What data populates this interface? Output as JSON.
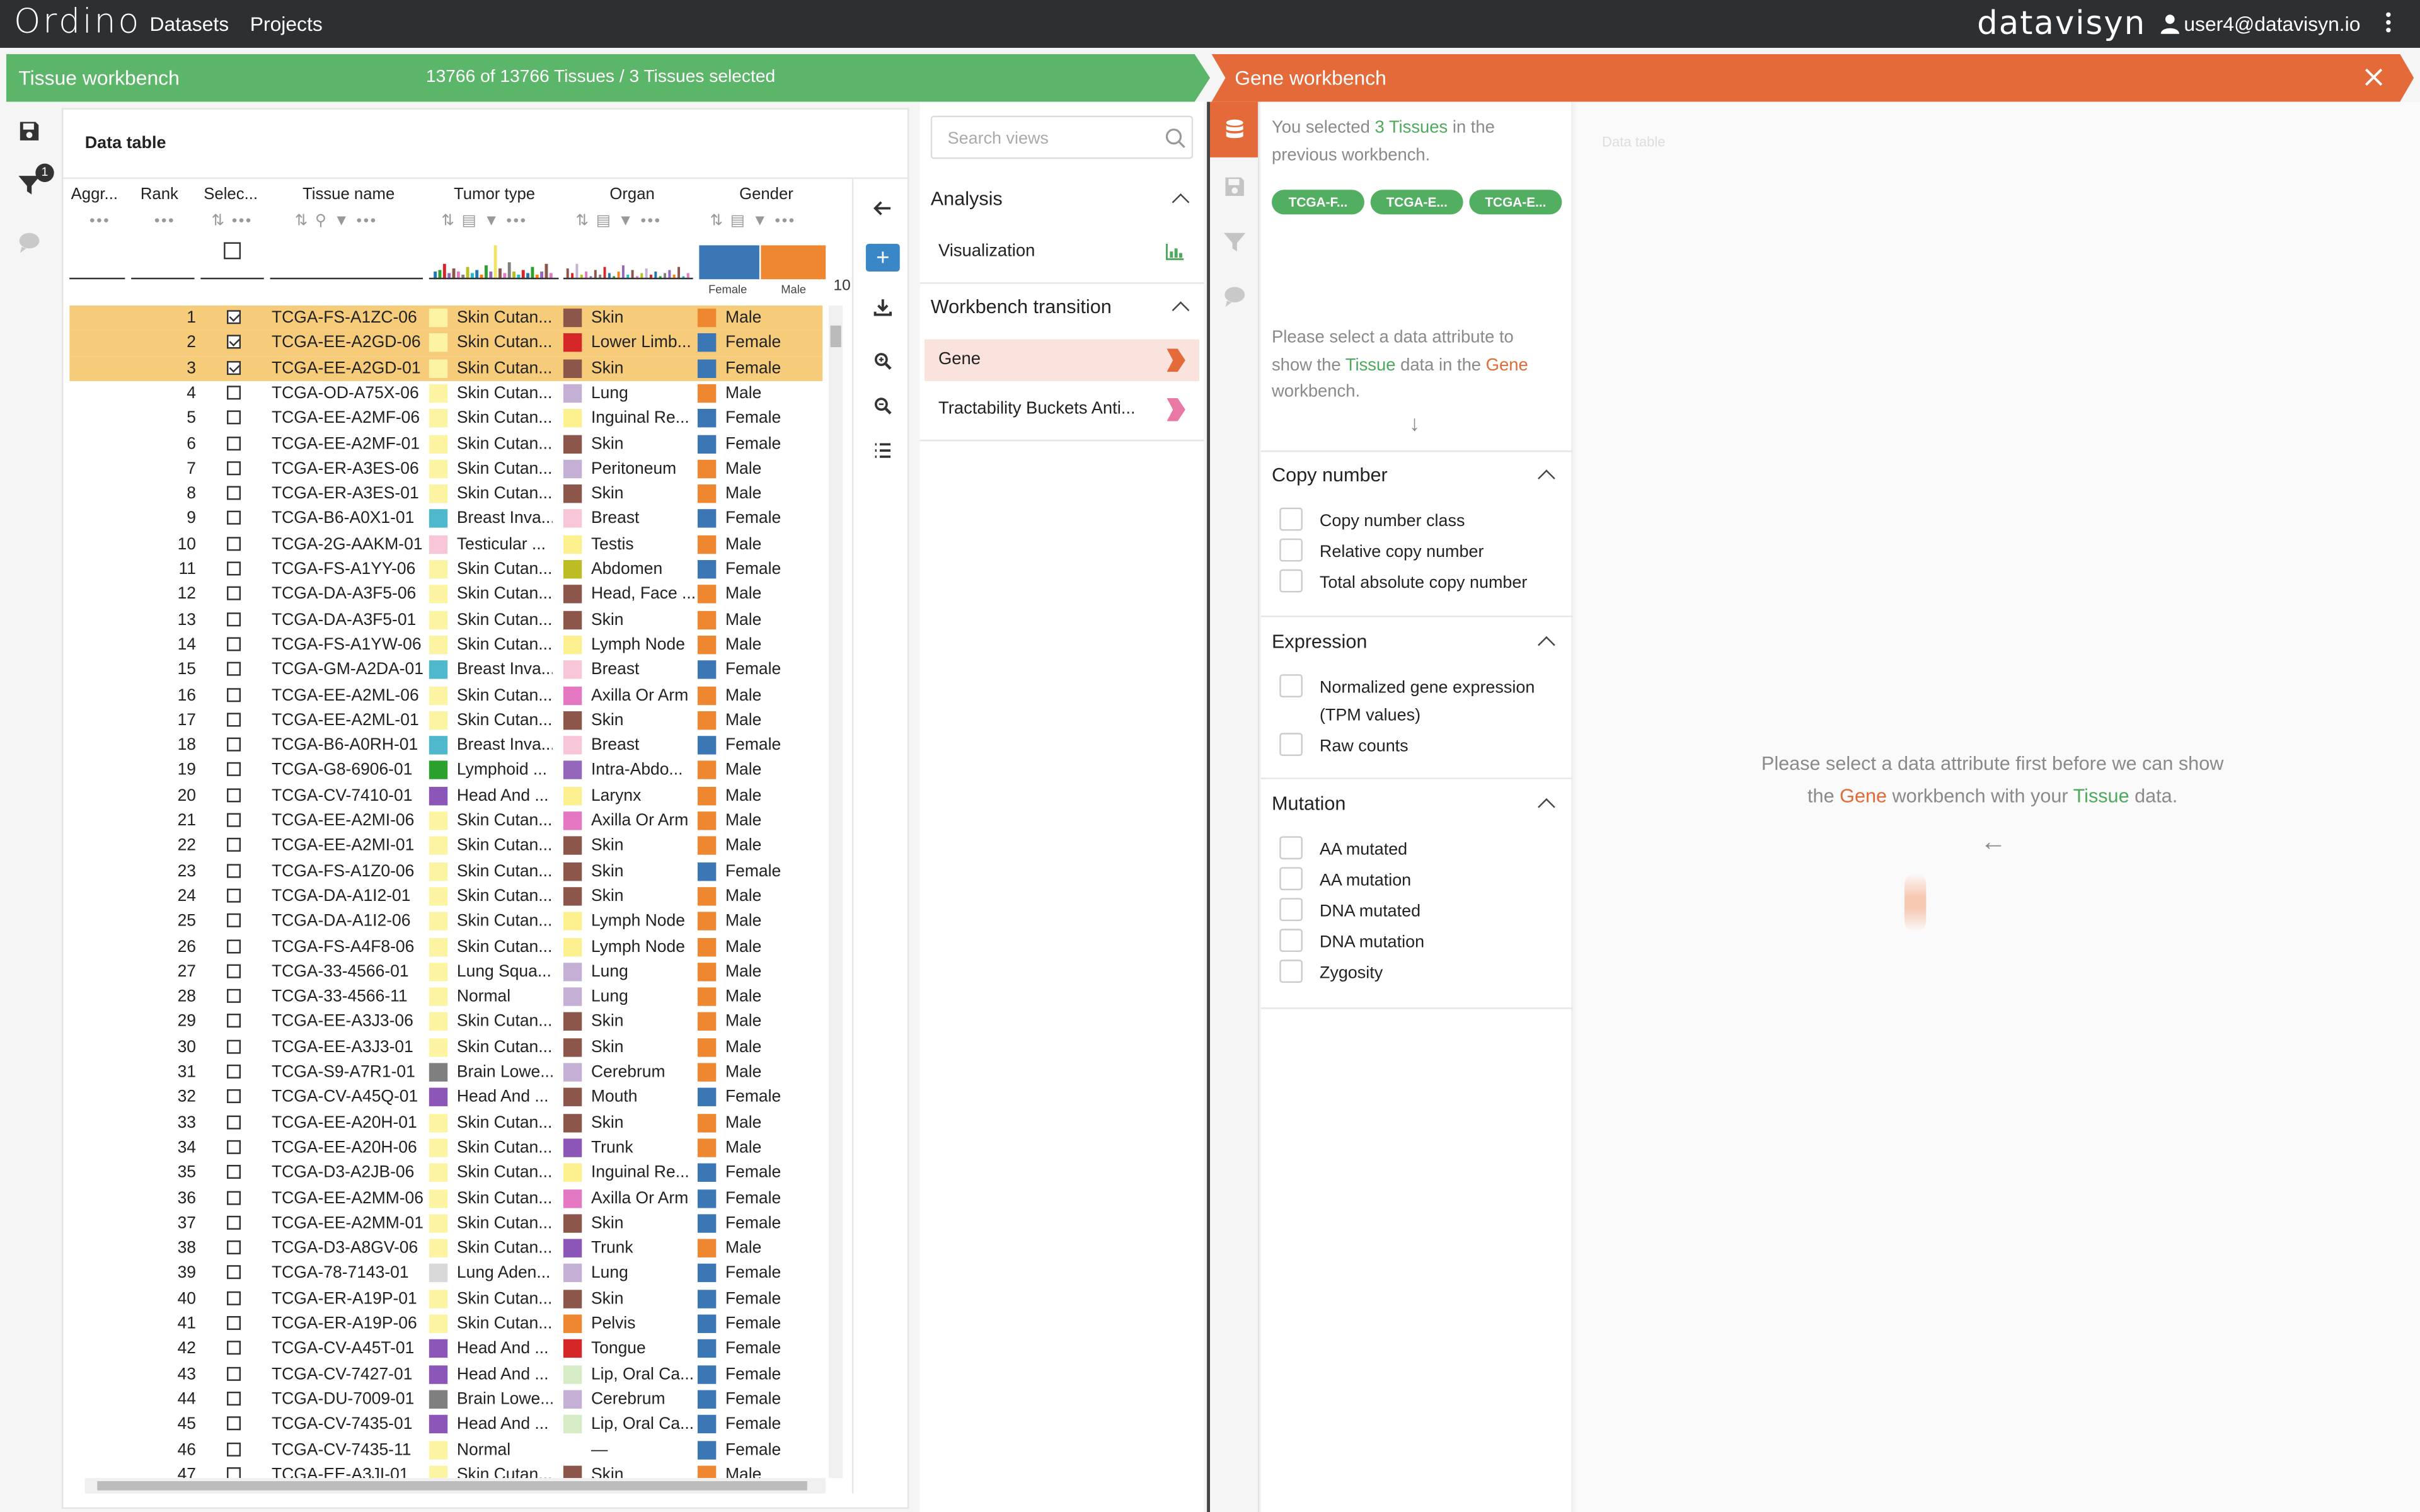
{
  "topbar": {
    "brand": "Ordino",
    "nav": [
      "Datasets",
      "Projects"
    ],
    "logo": "datavisyn",
    "user": "user4@datavisyn.io"
  },
  "tissue_workbench": {
    "title": "Tissue workbench",
    "status": "13766 of 13766 Tissues / 3 Tissues selected",
    "filter_badge": "1"
  },
  "gene_workbench": {
    "title": "Gene workbench"
  },
  "data_table": {
    "title": "Data table",
    "columns": [
      "Aggr...",
      "Rank",
      "Selec...",
      "Tissue name",
      "Tumor type",
      "Organ",
      "Gender"
    ],
    "gender_hist": {
      "female_label": "Female",
      "male_label": "Male",
      "female_fraction": 0.49,
      "overflow": "10"
    },
    "rows": [
      {
        "rank": "1",
        "name": "TCGA-FS-A1ZC-06",
        "tumor": "Skin Cutan...",
        "tc": "#fdf4a3",
        "organ": "Skin",
        "oc": "#8c564b",
        "gender": "Male",
        "sel": true
      },
      {
        "rank": "2",
        "name": "TCGA-EE-A2GD-06",
        "tumor": "Skin Cutan...",
        "tc": "#fdf4a3",
        "organ": "Lower Limb...",
        "oc": "#d62728",
        "gender": "Female",
        "sel": true
      },
      {
        "rank": "3",
        "name": "TCGA-EE-A2GD-01",
        "tumor": "Skin Cutan...",
        "tc": "#fdf4a3",
        "organ": "Skin",
        "oc": "#8c564b",
        "gender": "Female",
        "sel": true
      },
      {
        "rank": "4",
        "name": "TCGA-OD-A75X-06",
        "tumor": "Skin Cutan...",
        "tc": "#fdf4a3",
        "organ": "Lung",
        "oc": "#c5b0d5",
        "gender": "Male",
        "sel": false
      },
      {
        "rank": "5",
        "name": "TCGA-EE-A2MF-06",
        "tumor": "Skin Cutan...",
        "tc": "#fdf4a3",
        "organ": "Inguinal Re...",
        "oc": "#fdf08f",
        "gender": "Female",
        "sel": false
      },
      {
        "rank": "6",
        "name": "TCGA-EE-A2MF-01",
        "tumor": "Skin Cutan...",
        "tc": "#fdf4a3",
        "organ": "Skin",
        "oc": "#8c564b",
        "gender": "Female",
        "sel": false
      },
      {
        "rank": "7",
        "name": "TCGA-ER-A3ES-06",
        "tumor": "Skin Cutan...",
        "tc": "#fdf4a3",
        "organ": "Peritoneum",
        "oc": "#c5b0d5",
        "gender": "Male",
        "sel": false
      },
      {
        "rank": "8",
        "name": "TCGA-ER-A3ES-01",
        "tumor": "Skin Cutan...",
        "tc": "#fdf4a3",
        "organ": "Skin",
        "oc": "#8c564b",
        "gender": "Male",
        "sel": false
      },
      {
        "rank": "9",
        "name": "TCGA-B6-A0X1-01",
        "tumor": "Breast Inva...",
        "tc": "#4fb8cc",
        "organ": "Breast",
        "oc": "#f7c6d9",
        "gender": "Female",
        "sel": false
      },
      {
        "rank": "10",
        "name": "TCGA-2G-AAKM-01",
        "tumor": "Testicular ...",
        "tc": "#f7c6d9",
        "organ": "Testis",
        "oc": "#fdf08f",
        "gender": "Male",
        "sel": false
      },
      {
        "rank": "11",
        "name": "TCGA-FS-A1YY-06",
        "tumor": "Skin Cutan...",
        "tc": "#fdf4a3",
        "organ": "Abdomen",
        "oc": "#bcbd22",
        "gender": "Female",
        "sel": false
      },
      {
        "rank": "12",
        "name": "TCGA-DA-A3F5-06",
        "tumor": "Skin Cutan...",
        "tc": "#fdf4a3",
        "organ": "Head, Face ...",
        "oc": "#8c564b",
        "gender": "Male",
        "sel": false
      },
      {
        "rank": "13",
        "name": "TCGA-DA-A3F5-01",
        "tumor": "Skin Cutan...",
        "tc": "#fdf4a3",
        "organ": "Skin",
        "oc": "#8c564b",
        "gender": "Male",
        "sel": false
      },
      {
        "rank": "14",
        "name": "TCGA-FS-A1YW-06",
        "tumor": "Skin Cutan...",
        "tc": "#fdf4a3",
        "organ": "Lymph Node",
        "oc": "#fdf08f",
        "gender": "Male",
        "sel": false
      },
      {
        "rank": "15",
        "name": "TCGA-GM-A2DA-01",
        "tumor": "Breast Inva...",
        "tc": "#4fb8cc",
        "organ": "Breast",
        "oc": "#f7c6d9",
        "gender": "Female",
        "sel": false
      },
      {
        "rank": "16",
        "name": "TCGA-EE-A2ML-06",
        "tumor": "Skin Cutan...",
        "tc": "#fdf4a3",
        "organ": "Axilla Or Arm",
        "oc": "#e377c2",
        "gender": "Male",
        "sel": false
      },
      {
        "rank": "17",
        "name": "TCGA-EE-A2ML-01",
        "tumor": "Skin Cutan...",
        "tc": "#fdf4a3",
        "organ": "Skin",
        "oc": "#8c564b",
        "gender": "Male",
        "sel": false
      },
      {
        "rank": "18",
        "name": "TCGA-B6-A0RH-01",
        "tumor": "Breast Inva...",
        "tc": "#4fb8cc",
        "organ": "Breast",
        "oc": "#f7c6d9",
        "gender": "Female",
        "sel": false
      },
      {
        "rank": "19",
        "name": "TCGA-G8-6906-01",
        "tumor": "Lymphoid ...",
        "tc": "#2ca02c",
        "organ": "Intra-Abdo...",
        "oc": "#9467bd",
        "gender": "Male",
        "sel": false
      },
      {
        "rank": "20",
        "name": "TCGA-CV-7410-01",
        "tumor": "Head And ...",
        "tc": "#8c55b8",
        "organ": "Larynx",
        "oc": "#fdf08f",
        "gender": "Male",
        "sel": false
      },
      {
        "rank": "21",
        "name": "TCGA-EE-A2MI-06",
        "tumor": "Skin Cutan...",
        "tc": "#fdf4a3",
        "organ": "Axilla Or Arm",
        "oc": "#e377c2",
        "gender": "Male",
        "sel": false
      },
      {
        "rank": "22",
        "name": "TCGA-EE-A2MI-01",
        "tumor": "Skin Cutan...",
        "tc": "#fdf4a3",
        "organ": "Skin",
        "oc": "#8c564b",
        "gender": "Male",
        "sel": false
      },
      {
        "rank": "23",
        "name": "TCGA-FS-A1Z0-06",
        "tumor": "Skin Cutan...",
        "tc": "#fdf4a3",
        "organ": "Skin",
        "oc": "#8c564b",
        "gender": "Female",
        "sel": false
      },
      {
        "rank": "24",
        "name": "TCGA-DA-A1I2-01",
        "tumor": "Skin Cutan...",
        "tc": "#fdf4a3",
        "organ": "Skin",
        "oc": "#8c564b",
        "gender": "Male",
        "sel": false
      },
      {
        "rank": "25",
        "name": "TCGA-DA-A1I2-06",
        "tumor": "Skin Cutan...",
        "tc": "#fdf4a3",
        "organ": "Lymph Node",
        "oc": "#fdf08f",
        "gender": "Male",
        "sel": false
      },
      {
        "rank": "26",
        "name": "TCGA-FS-A4F8-06",
        "tumor": "Skin Cutan...",
        "tc": "#fdf4a3",
        "organ": "Lymph Node",
        "oc": "#fdf08f",
        "gender": "Male",
        "sel": false
      },
      {
        "rank": "27",
        "name": "TCGA-33-4566-01",
        "tumor": "Lung Squa...",
        "tc": "#fdf4a3",
        "organ": "Lung",
        "oc": "#c5b0d5",
        "gender": "Male",
        "sel": false
      },
      {
        "rank": "28",
        "name": "TCGA-33-4566-11",
        "tumor": "Normal",
        "tc": "#fdf4a3",
        "organ": "Lung",
        "oc": "#c5b0d5",
        "gender": "Male",
        "sel": false
      },
      {
        "rank": "29",
        "name": "TCGA-EE-A3J3-06",
        "tumor": "Skin Cutan...",
        "tc": "#fdf4a3",
        "organ": "Skin",
        "oc": "#8c564b",
        "gender": "Male",
        "sel": false
      },
      {
        "rank": "30",
        "name": "TCGA-EE-A3J3-01",
        "tumor": "Skin Cutan...",
        "tc": "#fdf4a3",
        "organ": "Skin",
        "oc": "#8c564b",
        "gender": "Male",
        "sel": false
      },
      {
        "rank": "31",
        "name": "TCGA-S9-A7R1-01",
        "tumor": "Brain Lowe...",
        "tc": "#7f7f7f",
        "organ": "Cerebrum",
        "oc": "#c5b0d5",
        "gender": "Male",
        "sel": false
      },
      {
        "rank": "32",
        "name": "TCGA-CV-A45Q-01",
        "tumor": "Head And ...",
        "tc": "#8c55b8",
        "organ": "Mouth",
        "oc": "#8c564b",
        "gender": "Female",
        "sel": false
      },
      {
        "rank": "33",
        "name": "TCGA-EE-A20H-01",
        "tumor": "Skin Cutan...",
        "tc": "#fdf4a3",
        "organ": "Skin",
        "oc": "#8c564b",
        "gender": "Male",
        "sel": false
      },
      {
        "rank": "34",
        "name": "TCGA-EE-A20H-06",
        "tumor": "Skin Cutan...",
        "tc": "#fdf4a3",
        "organ": "Trunk",
        "oc": "#8c55b8",
        "gender": "Male",
        "sel": false
      },
      {
        "rank": "35",
        "name": "TCGA-D3-A2JB-06",
        "tumor": "Skin Cutan...",
        "tc": "#fdf4a3",
        "organ": "Inguinal Re...",
        "oc": "#fdf08f",
        "gender": "Female",
        "sel": false
      },
      {
        "rank": "36",
        "name": "TCGA-EE-A2MM-06",
        "tumor": "Skin Cutan...",
        "tc": "#fdf4a3",
        "organ": "Axilla Or Arm",
        "oc": "#e377c2",
        "gender": "Female",
        "sel": false
      },
      {
        "rank": "37",
        "name": "TCGA-EE-A2MM-01",
        "tumor": "Skin Cutan...",
        "tc": "#fdf4a3",
        "organ": "Skin",
        "oc": "#8c564b",
        "gender": "Female",
        "sel": false
      },
      {
        "rank": "38",
        "name": "TCGA-D3-A8GV-06",
        "tumor": "Skin Cutan...",
        "tc": "#fdf4a3",
        "organ": "Trunk",
        "oc": "#8c55b8",
        "gender": "Male",
        "sel": false
      },
      {
        "rank": "39",
        "name": "TCGA-78-7143-01",
        "tumor": "Lung Aden...",
        "tc": "#d9d9d9",
        "organ": "Lung",
        "oc": "#c5b0d5",
        "gender": "Female",
        "sel": false
      },
      {
        "rank": "40",
        "name": "TCGA-ER-A19P-01",
        "tumor": "Skin Cutan...",
        "tc": "#fdf4a3",
        "organ": "Skin",
        "oc": "#8c564b",
        "gender": "Female",
        "sel": false
      },
      {
        "rank": "41",
        "name": "TCGA-ER-A19P-06",
        "tumor": "Skin Cutan...",
        "tc": "#fdf4a3",
        "organ": "Pelvis",
        "oc": "#ef8630",
        "gender": "Female",
        "sel": false
      },
      {
        "rank": "42",
        "name": "TCGA-CV-A45T-01",
        "tumor": "Head And ...",
        "tc": "#8c55b8",
        "organ": "Tongue",
        "oc": "#d62728",
        "gender": "Female",
        "sel": false
      },
      {
        "rank": "43",
        "name": "TCGA-CV-7427-01",
        "tumor": "Head And ...",
        "tc": "#8c55b8",
        "organ": "Lip, Oral Ca...",
        "oc": "#d5ecc7",
        "gender": "Female",
        "sel": false
      },
      {
        "rank": "44",
        "name": "TCGA-DU-7009-01",
        "tumor": "Brain Lowe...",
        "tc": "#7f7f7f",
        "organ": "Cerebrum",
        "oc": "#c5b0d5",
        "gender": "Female",
        "sel": false
      },
      {
        "rank": "45",
        "name": "TCGA-CV-7435-01",
        "tumor": "Head And ...",
        "tc": "#8c55b8",
        "organ": "Lip, Oral Ca...",
        "oc": "#d5ecc7",
        "gender": "Female",
        "sel": false
      },
      {
        "rank": "46",
        "name": "TCGA-CV-7435-11",
        "tumor": "Normal",
        "tc": "#fdf4a3",
        "organ": "—",
        "oc": "transparent",
        "gender": "Female",
        "sel": false
      },
      {
        "rank": "47",
        "name": "TCGA-EE-A3JI-01",
        "tumor": "Skin Cutan...",
        "tc": "#fdf4a3",
        "organ": "Skin",
        "oc": "#8c564b",
        "gender": "Male",
        "sel": false
      }
    ]
  },
  "views": {
    "search_placeholder": "Search views",
    "analysis": {
      "title": "Analysis",
      "items": [
        "Visualization"
      ]
    },
    "transition": {
      "title": "Workbench transition",
      "items": [
        "Gene",
        "Tractability Buckets Anti..."
      ]
    }
  },
  "gene_panel": {
    "info_pre": "You selected ",
    "info_count": "3 Tissues",
    "info_post": " in the previous workbench.",
    "chips": [
      "TCGA-F...",
      "TCGA-E...",
      "TCGA-E..."
    ],
    "hint_pre": "Please select a data attribute to show the ",
    "hint_tissue": "Tissue",
    "hint_mid": " data in the ",
    "hint_gene": "Gene",
    "hint_post": " workbench.",
    "sections": [
      {
        "title": "Copy number",
        "options": [
          "Copy number class",
          "Relative copy number",
          "Total absolute copy number"
        ]
      },
      {
        "title": "Expression",
        "options": [
          "Normalized gene expression (TPM values)",
          "Raw counts"
        ]
      },
      {
        "title": "Mutation",
        "options": [
          "AA mutated",
          "AA mutation",
          "DNA mutated",
          "DNA mutation",
          "Zygosity"
        ]
      }
    ]
  },
  "gene_main": {
    "faint": "Data table",
    "msg_pre": "Please select a data attribute first before we can show the ",
    "msg_gene": "Gene",
    "msg_mid": " workbench with your ",
    "msg_tissue": "Tissue",
    "msg_post": " data."
  },
  "colors": {
    "green": "#5cb66a",
    "orange": "#e46a3a",
    "selected_row": "#f6cc7a",
    "female": "#3a77b4",
    "male": "#ef8630"
  }
}
